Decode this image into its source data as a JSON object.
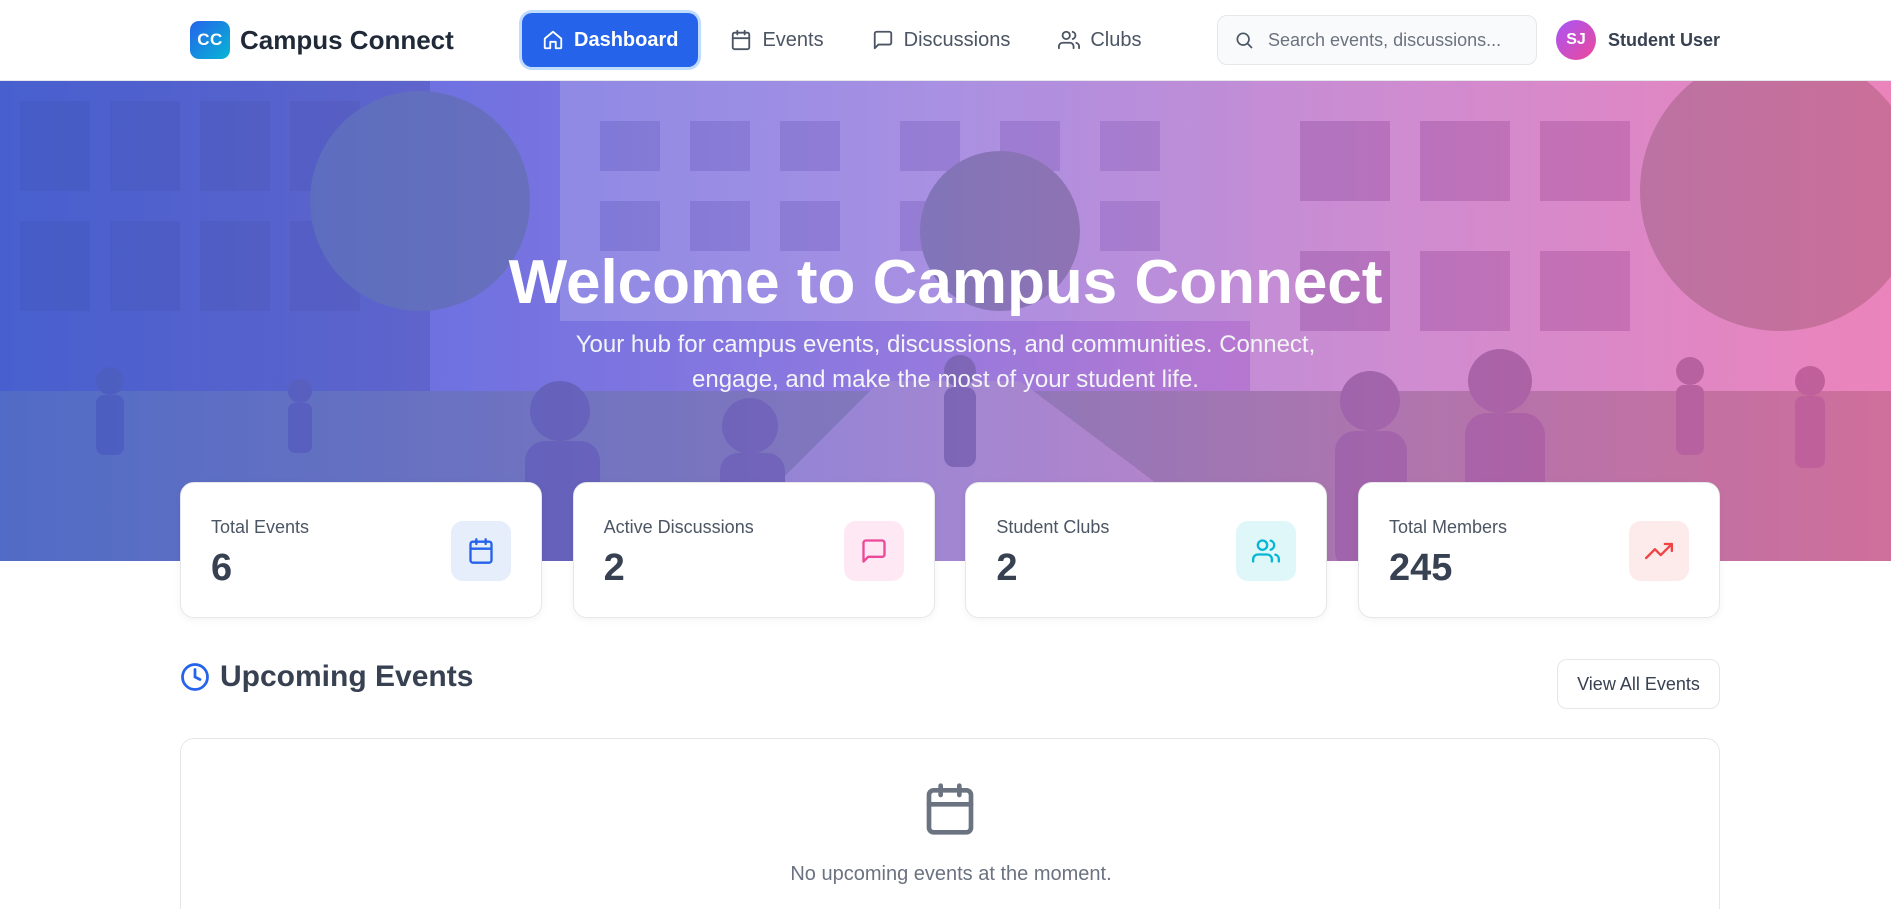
{
  "app": {
    "logo_initials": "CC",
    "name": "Campus Connect"
  },
  "nav": {
    "items": [
      {
        "label": "Dashboard",
        "icon": "home-icon",
        "active": true
      },
      {
        "label": "Events",
        "icon": "calendar-icon",
        "active": false
      },
      {
        "label": "Discussions",
        "icon": "message-icon",
        "active": false
      },
      {
        "label": "Clubs",
        "icon": "users-icon",
        "active": false
      }
    ]
  },
  "search": {
    "placeholder": "Search events, discussions...",
    "value": ""
  },
  "user": {
    "initials": "SJ",
    "name": "Student User"
  },
  "hero": {
    "title": "Welcome to Campus Connect",
    "subtitle": "Your hub for campus events, discussions, and communities. Connect, engage, and make the most of your student life."
  },
  "stats": [
    {
      "label": "Total Events",
      "value": "6",
      "icon": "calendar-icon",
      "color": "#2563eb",
      "bg": "#e6edfb"
    },
    {
      "label": "Active Discussions",
      "value": "2",
      "icon": "message-icon",
      "color": "#ec4899",
      "bg": "#fde8f3"
    },
    {
      "label": "Student Clubs",
      "value": "2",
      "icon": "users-icon",
      "color": "#06b6d4",
      "bg": "#e0f7fa"
    },
    {
      "label": "Total Members",
      "value": "245",
      "icon": "trending-up-icon",
      "color": "#ef4444",
      "bg": "#fdeaea"
    }
  ],
  "upcoming": {
    "title": "Upcoming Events",
    "view_all_label": "View All Events",
    "empty_text": "No upcoming events at the moment."
  },
  "colors": {
    "primary": "#2563eb",
    "text": "#374151",
    "muted": "#6b7280"
  }
}
